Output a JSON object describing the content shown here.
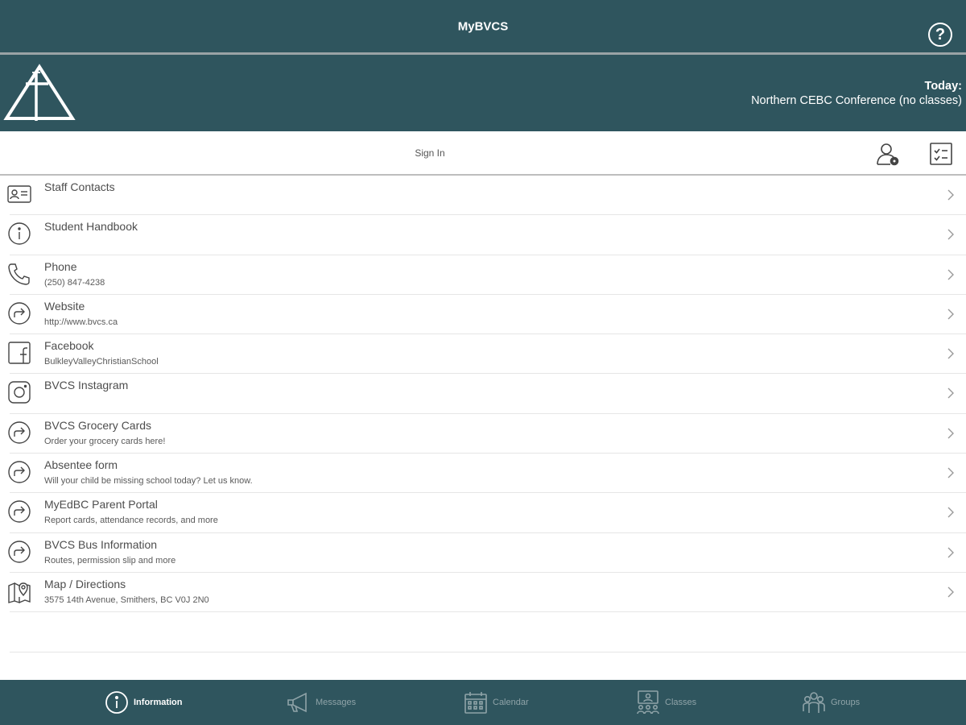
{
  "header": {
    "title": "MyBVCS",
    "help_icon": "help-circle-icon"
  },
  "banner": {
    "logo": "school-logo",
    "today_label": "Today:",
    "today_event": "Northern CEBC Conference (no classes)"
  },
  "signin": {
    "label": "Sign In",
    "icons": [
      "user-settings-icon",
      "checklist-icon"
    ]
  },
  "items": [
    {
      "title": "Staff Contacts",
      "subtitle": "",
      "icon": "contact-card-icon"
    },
    {
      "title": "Student Handbook",
      "subtitle": "",
      "icon": "info-circle-icon"
    },
    {
      "title": "Phone",
      "subtitle": "(250) 847-4238",
      "icon": "phone-icon"
    },
    {
      "title": "Website",
      "subtitle": "http://www.bvcs.ca",
      "icon": "share-arrow-icon"
    },
    {
      "title": "Facebook",
      "subtitle": "BulkleyValleyChristianSchool",
      "icon": "facebook-icon"
    },
    {
      "title": "BVCS Instagram",
      "subtitle": "",
      "icon": "instagram-icon"
    },
    {
      "title": "BVCS Grocery Cards",
      "subtitle": "Order your grocery cards here!",
      "icon": "share-arrow-icon"
    },
    {
      "title": "Absentee form",
      "subtitle": "Will your child be missing school today? Let us know.",
      "icon": "share-arrow-icon"
    },
    {
      "title": "MyEdBC Parent Portal",
      "subtitle": "Report cards, attendance records, and more",
      "icon": "share-arrow-icon"
    },
    {
      "title": "BVCS Bus Information",
      "subtitle": "Routes, permission slip and more",
      "icon": "share-arrow-icon"
    },
    {
      "title": "Map / Directions",
      "subtitle": "3575 14th Avenue, Smithers, BC V0J 2N0",
      "icon": "map-pin-icon"
    }
  ],
  "tabs": [
    {
      "label": "Information",
      "icon": "info-circle-icon",
      "active": true
    },
    {
      "label": "Messages",
      "icon": "megaphone-icon",
      "active": false
    },
    {
      "label": "Calendar",
      "icon": "calendar-icon",
      "active": false
    },
    {
      "label": "Classes",
      "icon": "classes-icon",
      "active": false
    },
    {
      "label": "Groups",
      "icon": "groups-icon",
      "active": false
    }
  ],
  "colors": {
    "primary": "#2f555e",
    "tab_inactive": "#8fa3a8",
    "text": "#4a4a4a"
  }
}
